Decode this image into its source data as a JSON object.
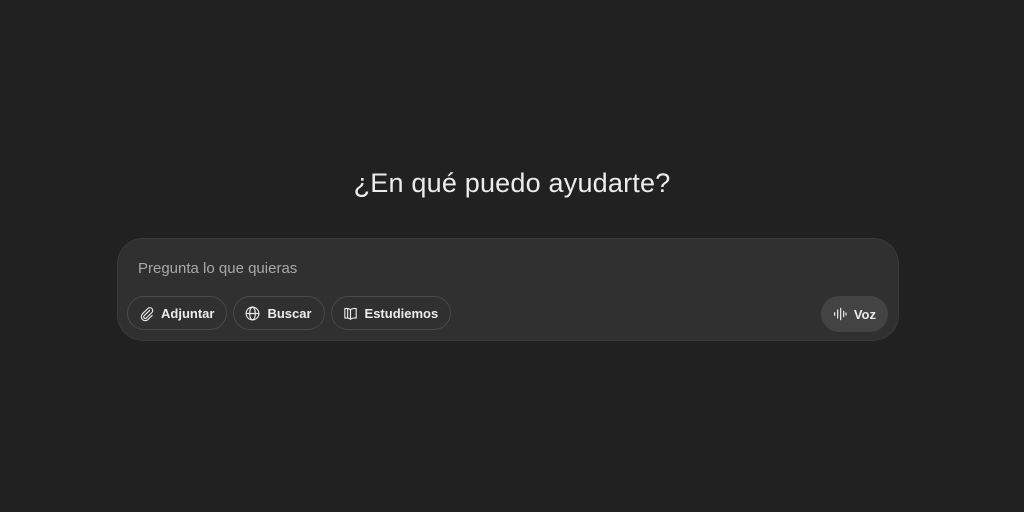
{
  "main": {
    "heading": "¿En qué puedo ayudarte?"
  },
  "composer": {
    "placeholder": "Pregunta lo que quieras",
    "value": "",
    "tools": {
      "attach_label": "Adjuntar",
      "attach_icon": "paperclip-icon",
      "search_label": "Buscar",
      "search_icon": "globe-icon",
      "study_label": "Estudiemos",
      "study_icon": "book-icon"
    },
    "voice_label": "Voz",
    "voice_icon": "voice-waveform-icon"
  },
  "colors": {
    "background": "#212121",
    "composer_bg": "#303030",
    "text": "#ececec",
    "placeholder": "#a8a8a8",
    "voice_button_bg": "#434343"
  }
}
